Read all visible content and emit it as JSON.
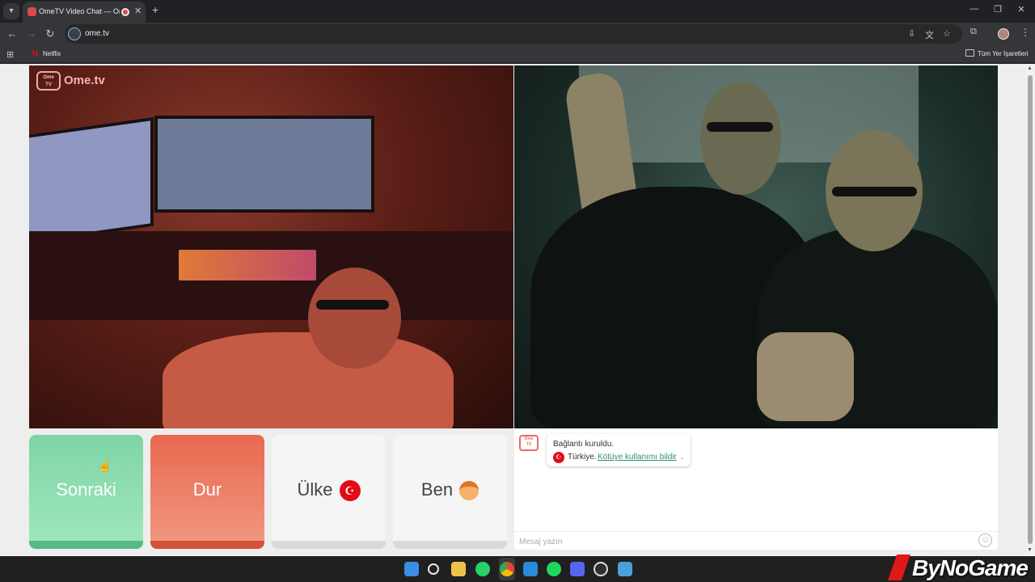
{
  "browser": {
    "tab_title": "OmeTV Video Chat — Ome",
    "url": "ome.tv",
    "bookmarks": [
      {
        "label": "Netflix",
        "icon": "netflix-icon"
      }
    ],
    "all_bookmarks_label": "Tüm Yer İşaretleri"
  },
  "site": {
    "logo_text": "Ome.tv",
    "logo_badge_top": "Ome",
    "logo_badge_bottom": "TV"
  },
  "controls": {
    "next_label": "Sonraki",
    "stop_label": "Dur",
    "country_label": "Ülke",
    "me_label": "Ben",
    "colors": {
      "next": "#7fd4a4",
      "stop": "#e8694f",
      "neutral": "#f5f5f5"
    }
  },
  "chat": {
    "system_message": "Bağlantı kuruldu.",
    "country": "Türkiye.",
    "report_link": "Kötüye kullanımı bildir",
    "report_suffix": ".",
    "input_placeholder": "Mesaj yazın",
    "emoji_icon": "smile-icon"
  },
  "taskbar": {
    "apps": [
      "windows-start-icon",
      "search-icon",
      "file-explorer-icon",
      "whatsapp-icon",
      "chrome-icon",
      "vscode-icon",
      "spotify-icon",
      "discord-icon",
      "obs-icon",
      "app-icon"
    ]
  },
  "watermark": {
    "text": "ByNoGame"
  }
}
